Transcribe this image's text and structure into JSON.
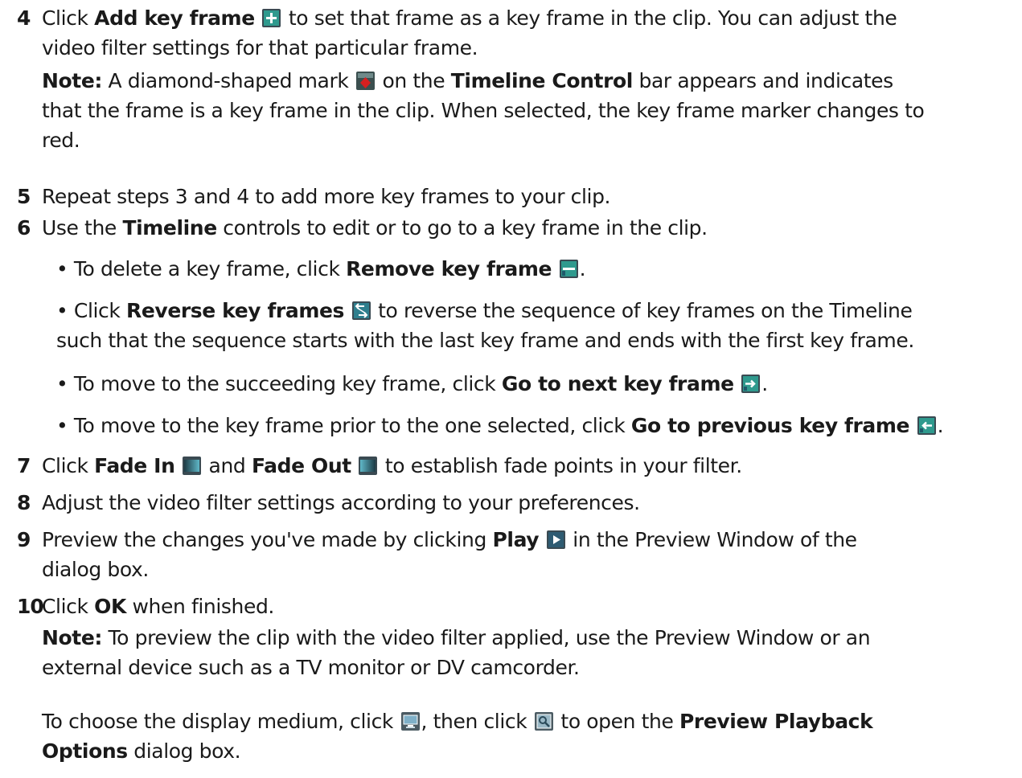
{
  "step4": {
    "num": "4",
    "t1": "Click ",
    "b1": "Add key frame",
    "t2": " to set that frame as a key frame in the clip. You can adjust the",
    "l2": "video filter settings for that particular frame.",
    "note_label": "Note:",
    "n1": "  A diamond-shaped mark ",
    "n2": " on the ",
    "n_b": "Timeline Control",
    "n3": " bar appears and indicates",
    "n4": "that the frame is a key frame in the clip. When selected, the key frame marker changes to",
    "n5": "red."
  },
  "step5": {
    "num": "5",
    "text": "Repeat steps 3 and 4 to add more key frames to your clip."
  },
  "step6": {
    "num": "6",
    "t1": "Use the ",
    "b1": "Timeline",
    "t2": " controls to edit or to go to a key frame in the clip."
  },
  "bullets": {
    "b1_t1": "• To delete a key frame, click ",
    "b1_b": "Remove key frame",
    "b1_t2": ".",
    "b2_t1": "• Click ",
    "b2_b": "Reverse key frames",
    "b2_t2": " to reverse the sequence of key frames on the Timeline",
    "b2_l2": "such that the sequence starts with the last key frame and ends with the first key frame.",
    "b3_t1": "• To move to the succeeding key frame, click ",
    "b3_b": "Go to next key frame",
    "b3_t2": ".",
    "b4_t1": "• To move to the key frame prior to the one selected, click ",
    "b4_b": "Go to previous key frame",
    "b4_t2": "."
  },
  "step7": {
    "num": "7",
    "t1": "Click ",
    "b1": "Fade In",
    "t2": " and ",
    "b2": "Fade Out",
    "t3": " to establish fade points in your filter."
  },
  "step8": {
    "num": "8",
    "text": "Adjust the video filter settings according to your preferences."
  },
  "step9": {
    "num": "9",
    "t1": "Preview the changes you've made by clicking ",
    "b1": "Play",
    "t2": " in the Preview Window of the",
    "l2": "dialog box."
  },
  "step10": {
    "num": "10",
    "t1": "Click ",
    "b1": "OK",
    "t2": " when finished.",
    "note_label": "Note:",
    "n1": "  To preview the clip with the video filter applied, use the Preview Window or an",
    "n2": "external device such as a TV monitor or DV camcorder.",
    "p1": "To choose the display medium, click ",
    "p2": ", then click ",
    "p3": " to open the ",
    "p_b1": "Preview Playback",
    "p_b2": "Options",
    "p4": " dialog box."
  },
  "icons": {
    "add_key_frame": "add-key-frame-icon",
    "key_frame_marker": "key-frame-marker-icon",
    "remove_key_frame": "remove-key-frame-icon",
    "reverse_key_frames": "reverse-key-frames-icon",
    "next_key_frame": "next-key-frame-icon",
    "previous_key_frame": "previous-key-frame-icon",
    "fade_in": "fade-in-icon",
    "fade_out": "fade-out-icon",
    "play": "play-icon",
    "display_medium": "display-medium-icon",
    "playback_options": "playback-options-icon"
  },
  "colors": {
    "icon_bg": "#2e8b8b",
    "marker_red": "#d62020",
    "text": "#1a1a1a"
  }
}
